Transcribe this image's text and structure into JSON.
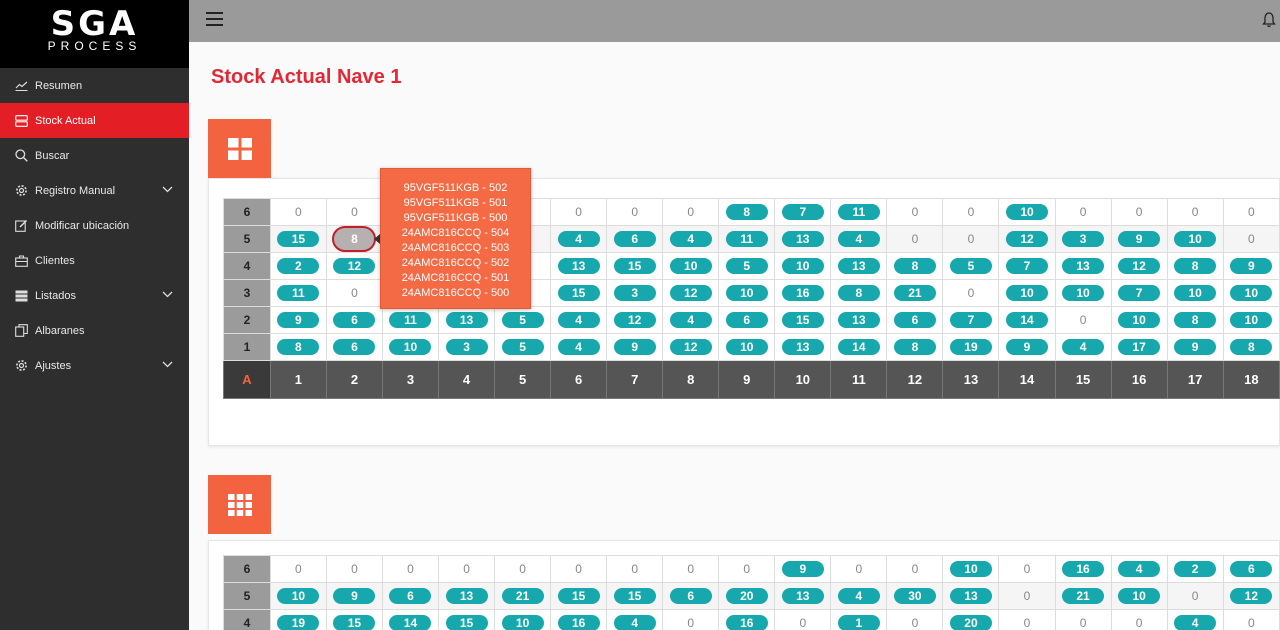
{
  "logo": {
    "main": "SGA",
    "sub": "PROCESS"
  },
  "nav": [
    {
      "label": "Resumen",
      "icon": "chart-line-icon",
      "active": false,
      "chevron": false
    },
    {
      "label": "Stock Actual",
      "icon": "storage-icon",
      "active": true,
      "chevron": false
    },
    {
      "label": "Buscar",
      "icon": "search-icon",
      "active": false,
      "chevron": false
    },
    {
      "label": "Registro Manual",
      "icon": "gear-icon",
      "active": false,
      "chevron": true
    },
    {
      "label": "Modificar ubicación",
      "icon": "edit-icon",
      "active": false,
      "chevron": false
    },
    {
      "label": "Clientes",
      "icon": "briefcase-icon",
      "active": false,
      "chevron": false
    },
    {
      "label": "Listados",
      "icon": "server-list-icon",
      "active": false,
      "chevron": true
    },
    {
      "label": "Albaranes",
      "icon": "documents-icon",
      "active": false,
      "chevron": false
    },
    {
      "label": "Ajustes",
      "icon": "gear-icon",
      "active": false,
      "chevron": true
    }
  ],
  "page_title": "Stock Actual Nave 1",
  "colors": {
    "accent": "#e31e24",
    "orange": "#f4633f",
    "teal": "#17a8ae",
    "title": "#e32835"
  },
  "grid1": {
    "aisle": "A",
    "columns": [
      "1",
      "2",
      "3",
      "4",
      "5",
      "6",
      "7",
      "8",
      "9",
      "10",
      "11",
      "12",
      "13",
      "14",
      "15",
      "16",
      "17",
      "18"
    ],
    "rows": [
      {
        "label": "6",
        "cells": [
          "0",
          "0",
          "",
          "",
          "",
          "0",
          "0",
          "0",
          "8",
          "7",
          "11",
          "0",
          "0",
          "10",
          "0",
          "0",
          "0",
          "0"
        ]
      },
      {
        "label": "5",
        "cells": [
          "15",
          "8",
          "",
          "",
          "",
          "4",
          "6",
          "4",
          "11",
          "13",
          "4",
          "0",
          "0",
          "12",
          "3",
          "9",
          "10",
          "0"
        ]
      },
      {
        "label": "4",
        "cells": [
          "2",
          "12",
          "",
          "",
          "",
          "13",
          "15",
          "10",
          "5",
          "10",
          "13",
          "8",
          "5",
          "7",
          "13",
          "12",
          "8",
          "9"
        ]
      },
      {
        "label": "3",
        "cells": [
          "11",
          "0",
          "",
          "",
          "",
          "15",
          "3",
          "12",
          "10",
          "16",
          "8",
          "21",
          "0",
          "10",
          "10",
          "7",
          "10",
          "10"
        ]
      },
      {
        "label": "2",
        "cells": [
          "9",
          "6",
          "11",
          "13",
          "5",
          "4",
          "12",
          "4",
          "6",
          "15",
          "13",
          "6",
          "7",
          "14",
          "0",
          "10",
          "8",
          "10"
        ]
      },
      {
        "label": "1",
        "cells": [
          "8",
          "6",
          "10",
          "3",
          "5",
          "4",
          "9",
          "12",
          "10",
          "13",
          "14",
          "8",
          "19",
          "9",
          "4",
          "17",
          "9",
          "8"
        ]
      }
    ]
  },
  "tooltip": {
    "lines": [
      "95VGF511KGB - 502",
      "95VGF511KGB - 501",
      "95VGF511KGB - 500",
      "24AMC816CCQ - 504",
      "24AMC816CCQ - 503",
      "24AMC816CCQ - 502",
      "24AMC816CCQ - 501",
      "24AMC816CCQ - 500"
    ]
  },
  "grid2": {
    "rows": [
      {
        "label": "6",
        "cells": [
          "0",
          "0",
          "0",
          "0",
          "0",
          "0",
          "0",
          "0",
          "0",
          "9",
          "0",
          "0",
          "10",
          "0",
          "16",
          "4",
          "2",
          "6"
        ]
      },
      {
        "label": "5",
        "cells": [
          "10",
          "9",
          "6",
          "13",
          "21",
          "15",
          "15",
          "6",
          "20",
          "13",
          "4",
          "30",
          "13",
          "0",
          "21",
          "10",
          "0",
          "12"
        ]
      },
      {
        "label": "4",
        "cells": [
          "19",
          "15",
          "14",
          "15",
          "10",
          "16",
          "4",
          "0",
          "16",
          "0",
          "1",
          "0",
          "20",
          "0",
          "0",
          "0",
          "4",
          "0"
        ]
      }
    ]
  }
}
